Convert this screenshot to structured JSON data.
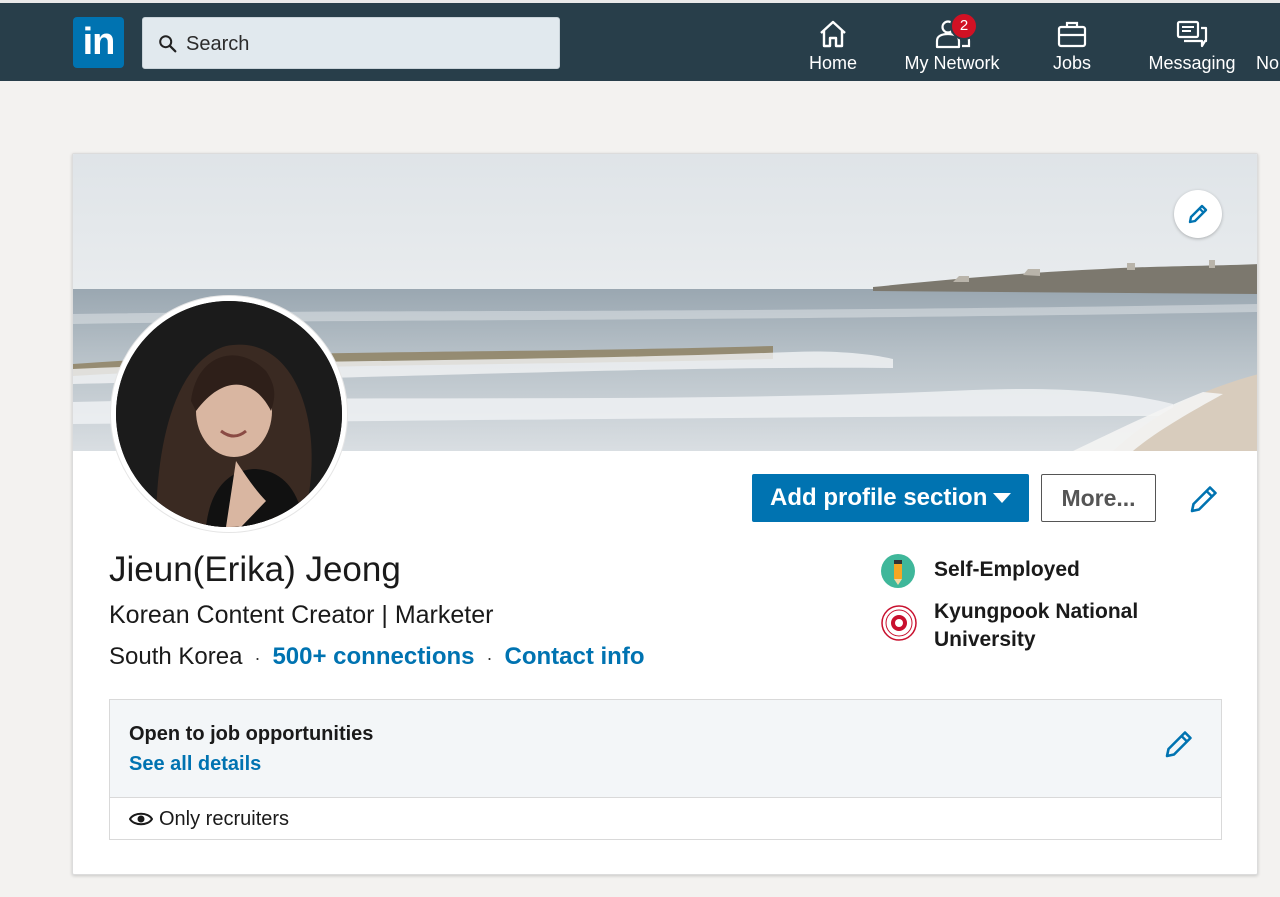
{
  "nav": {
    "logo_text": "in",
    "search_placeholder": "Search",
    "items": [
      {
        "label": "Home",
        "icon": "home-icon"
      },
      {
        "label": "My Network",
        "icon": "network-icon",
        "badge": "2"
      },
      {
        "label": "Jobs",
        "icon": "briefcase-icon"
      },
      {
        "label": "Messaging",
        "icon": "messaging-icon"
      },
      {
        "label": "No",
        "icon": "notifications-icon"
      }
    ]
  },
  "profile": {
    "name": "Jieun(Erika) Jeong",
    "headline": "Korean Content Creator | Marketer",
    "location": "South Korea",
    "separator": "·",
    "connections": "500+ connections",
    "contact": "Contact info",
    "add_section_label": "Add profile section",
    "more_label": "More...",
    "affiliations": [
      {
        "label": "Self-Employed",
        "icon": "pencil-logo-icon"
      },
      {
        "label": "Kyungpook National University",
        "icon": "university-seal-icon"
      }
    ]
  },
  "open_to_work": {
    "title": "Open to job opportunities",
    "link": "See all details",
    "visibility": "Only recruiters"
  },
  "colors": {
    "nav_bg": "#283e4a",
    "brand_blue": "#0073b1",
    "badge_red": "#d11124",
    "page_bg": "#f3f2f0"
  }
}
